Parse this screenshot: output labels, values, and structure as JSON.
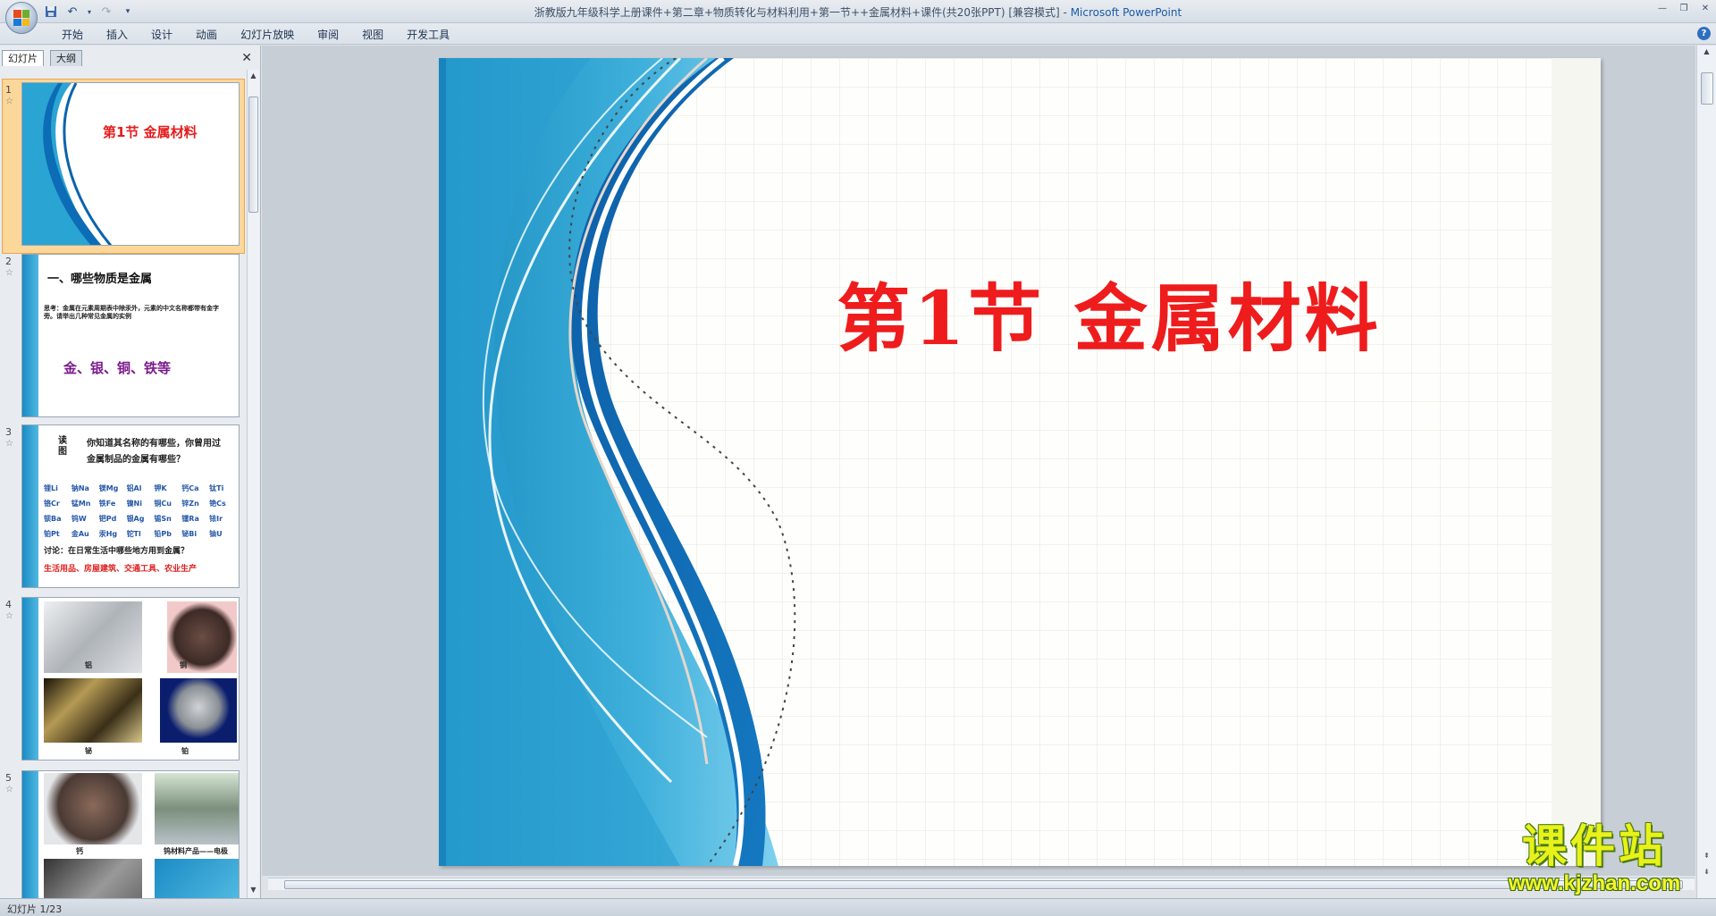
{
  "window": {
    "title": "浙教版九年级科学上册课件+第二章+物质转化与材料利用+第一节++金属材料+课件(共20张PPT) [兼容模式]",
    "app_name": "Microsoft PowerPoint"
  },
  "ribbon": {
    "tabs": [
      "开始",
      "插入",
      "设计",
      "动画",
      "幻灯片放映",
      "审阅",
      "视图",
      "开发工具"
    ]
  },
  "left_panel": {
    "tab_slides": "幻灯片",
    "tab_outline": "大纲",
    "close": "✕"
  },
  "thumbnails": [
    {
      "num": "1",
      "title": "第1节  金属材料"
    },
    {
      "num": "2",
      "heading": "一、哪些物质是金属",
      "question": "思考：金属在元素周期表中除汞外，元素的中文名称都带有金字旁。请举出几种常见金属的实例",
      "answer": "金、银、铜、铁等"
    },
    {
      "num": "3",
      "label": "读图",
      "question": "你知道其名称的有哪些，你曾用过金属制品的金属有哪些？",
      "elements": [
        "锂Li",
        "钠Na",
        "镁Mg",
        "铝Al",
        "钾K",
        "钙Ca",
        "钛Ti",
        "铬Cr",
        "锰Mn",
        "铁Fe",
        "镍Ni",
        "铜Cu",
        "锌Zn",
        "铯Cs",
        "钡Ba",
        "钨W",
        "钯Pd",
        "银Ag",
        "锡Sn",
        "镭Ra",
        "铱Ir",
        "铂Pt",
        "金Au",
        "汞Hg",
        "铊Tl",
        "铅Pb",
        "铋Bi",
        "铀U"
      ],
      "discussion": "讨论：在日常生活中哪些地方用到金属？",
      "answer": "生活用品、房屋建筑、交通工具、农业生产"
    },
    {
      "num": "4",
      "captions": [
        "铝",
        "铜",
        "铋",
        "铂"
      ]
    },
    {
      "num": "5",
      "captions": [
        "钙",
        "钨材料产品——电极"
      ]
    }
  ],
  "slide": {
    "title": "第1节  金属材料"
  },
  "status": {
    "slide_indicator": "幻灯片 1/23"
  },
  "watermark": {
    "brand": "课件站",
    "url": "www.kjzhan.com"
  }
}
